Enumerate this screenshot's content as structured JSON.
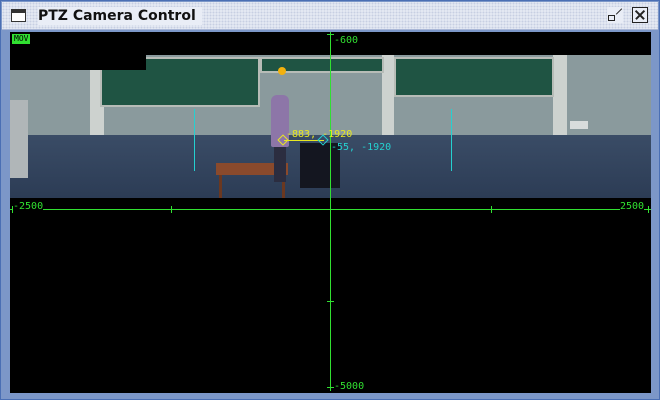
{
  "window": {
    "title": "PTZ Camera Control"
  },
  "controls": {
    "restore_icon": "restore-window-icon",
    "close_icon": "close-icon"
  },
  "overlay": {
    "mode": "MOV",
    "pan_axis": {
      "min_label": "-2500",
      "max_label": "2500"
    },
    "tilt_axis": {
      "top_label": "-600",
      "bottom_label": "-5000"
    },
    "target_coord": "-883, -1920",
    "current_coord": "-55, -1920",
    "colors": {
      "grid": "#31e031",
      "target": "#e8e822",
      "current": "#25d0d0",
      "marker": "#f2b10e"
    }
  }
}
